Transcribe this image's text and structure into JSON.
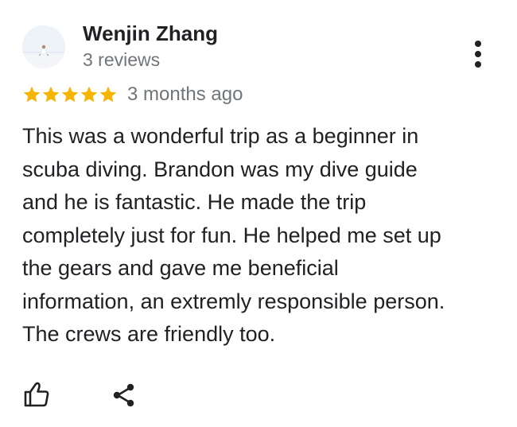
{
  "review": {
    "author_name": "Wenjin Zhang",
    "author_reviews": "3 reviews",
    "rating": 5,
    "rating_max": 5,
    "star_color": "#F4B400",
    "date": "3 months ago",
    "text_lines": [
      "This was a wonderful trip as a beginner in",
      "scuba diving. Brandon was my dive guide",
      "and he is fantastic. He made the trip",
      "completely just for fun. He helped me set up",
      "the gears and gave me beneficial",
      "information, an extremly responsible person.",
      "The crews are friendly too."
    ]
  },
  "icons": {
    "avatar": "profile-photo",
    "more": "more-vertical-icon",
    "like": "thumbs-up-icon",
    "share": "share-icon"
  }
}
